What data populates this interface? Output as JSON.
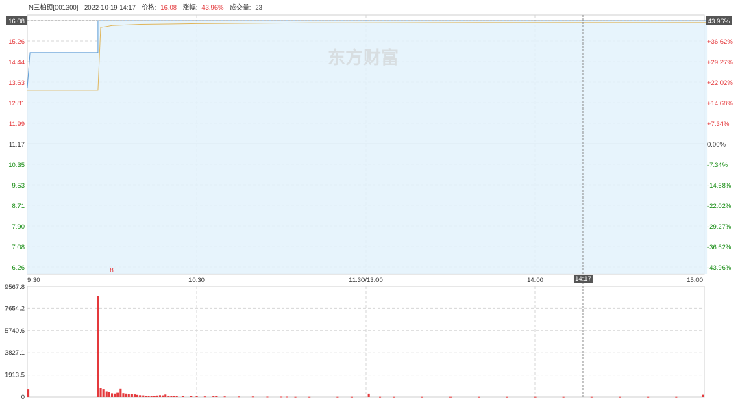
{
  "header": {
    "name": "N三柏硕[001300]",
    "datetime": "2022-10-19 14:17",
    "price_label": "价格:",
    "price": "16.08",
    "change_label": "涨幅:",
    "change": "43.96%",
    "volume_label": "成交量:",
    "volume": "23"
  },
  "watermark": "东方财富",
  "colors": {
    "price_line": "#5b9bd5",
    "avg_line": "#e0b55a",
    "area_fill": "#e3f2fb",
    "up": "#e4393c",
    "down": "#138a0f",
    "grid": "#d6d6d6",
    "highlight_box": "#555555"
  },
  "chart_data": [
    {
      "type": "line",
      "title": "",
      "price_ticks": [
        "16.08",
        "15.26",
        "14.44",
        "13.63",
        "12.81",
        "11.99",
        "11.17",
        "10.35",
        "9.53",
        "8.71",
        "7.90",
        "7.08",
        "6.26"
      ],
      "pct_ticks": [
        "43.96%",
        "+36.62%",
        "+29.27%",
        "+22.02%",
        "+14.68%",
        "+7.34%",
        "0.00%",
        "-7.34%",
        "-14.68%",
        "-22.02%",
        "-29.27%",
        "-36.62%",
        "-43.96%"
      ],
      "time_ticks": [
        "9:30",
        "10:30",
        "11:30/13:00",
        "14:00",
        "15:00"
      ],
      "cursor_time": "14:17",
      "cursor_price": "16.08",
      "cursor_pct": "43.96%",
      "marker_text": "8",
      "ylim": [
        6.26,
        16.08
      ],
      "prev_close": 11.17,
      "series": [
        {
          "points": [
            [
              0,
              13.4
            ],
            [
              1,
              14.8
            ],
            [
              5,
              14.8
            ],
            [
              25,
              14.8
            ],
            [
              25,
              16.08
            ],
            [
              241,
              16.08
            ]
          ]
        },
        {
          "points": [
            [
              0,
              13.3
            ],
            [
              1,
              13.3
            ],
            [
              25,
              13.3
            ],
            [
              26,
              15.8
            ],
            [
              30,
              15.88
            ],
            [
              40,
              15.93
            ],
            [
              60,
              15.96
            ],
            [
              100,
              15.99
            ],
            [
              160,
              16.0
            ],
            [
              241,
              16.0
            ]
          ]
        }
      ]
    },
    {
      "type": "bar",
      "title": "",
      "volume_ticks": [
        "9567.8",
        "7654.2",
        "5740.6",
        "3827.1",
        "1913.5",
        "0"
      ],
      "ylim": [
        0,
        9567.8
      ],
      "values": [
        {
          "i": 0,
          "v": 700
        },
        {
          "i": 25,
          "v": 8700
        },
        {
          "i": 26,
          "v": 800
        },
        {
          "i": 27,
          "v": 700
        },
        {
          "i": 28,
          "v": 500
        },
        {
          "i": 29,
          "v": 420
        },
        {
          "i": 30,
          "v": 330
        },
        {
          "i": 31,
          "v": 310
        },
        {
          "i": 32,
          "v": 380
        },
        {
          "i": 33,
          "v": 720
        },
        {
          "i": 34,
          "v": 340
        },
        {
          "i": 35,
          "v": 310
        },
        {
          "i": 36,
          "v": 290
        },
        {
          "i": 37,
          "v": 250
        },
        {
          "i": 38,
          "v": 230
        },
        {
          "i": 39,
          "v": 190
        },
        {
          "i": 40,
          "v": 160
        },
        {
          "i": 41,
          "v": 140
        },
        {
          "i": 42,
          "v": 120
        },
        {
          "i": 43,
          "v": 110
        },
        {
          "i": 44,
          "v": 100
        },
        {
          "i": 45,
          "v": 95
        },
        {
          "i": 46,
          "v": 130
        },
        {
          "i": 47,
          "v": 160
        },
        {
          "i": 48,
          "v": 140
        },
        {
          "i": 49,
          "v": 220
        },
        {
          "i": 50,
          "v": 120
        },
        {
          "i": 51,
          "v": 100
        },
        {
          "i": 52,
          "v": 90
        },
        {
          "i": 53,
          "v": 80
        },
        {
          "i": 55,
          "v": 70
        },
        {
          "i": 58,
          "v": 60
        },
        {
          "i": 60,
          "v": 60
        },
        {
          "i": 63,
          "v": 50
        },
        {
          "i": 66,
          "v": 80
        },
        {
          "i": 67,
          "v": 70
        },
        {
          "i": 70,
          "v": 50
        },
        {
          "i": 75,
          "v": 40
        },
        {
          "i": 80,
          "v": 40
        },
        {
          "i": 85,
          "v": 30
        },
        {
          "i": 90,
          "v": 30
        },
        {
          "i": 92,
          "v": 30
        },
        {
          "i": 95,
          "v": 20
        },
        {
          "i": 100,
          "v": 20
        },
        {
          "i": 110,
          "v": 20
        },
        {
          "i": 115,
          "v": 20
        },
        {
          "i": 121,
          "v": 300
        },
        {
          "i": 125,
          "v": 20
        },
        {
          "i": 130,
          "v": 20
        },
        {
          "i": 140,
          "v": 20
        },
        {
          "i": 150,
          "v": 20
        },
        {
          "i": 160,
          "v": 15
        },
        {
          "i": 170,
          "v": 15
        },
        {
          "i": 180,
          "v": 15
        },
        {
          "i": 190,
          "v": 15
        },
        {
          "i": 200,
          "v": 15
        },
        {
          "i": 210,
          "v": 15
        },
        {
          "i": 220,
          "v": 15
        },
        {
          "i": 230,
          "v": 15
        },
        {
          "i": 240,
          "v": 200
        }
      ]
    }
  ]
}
